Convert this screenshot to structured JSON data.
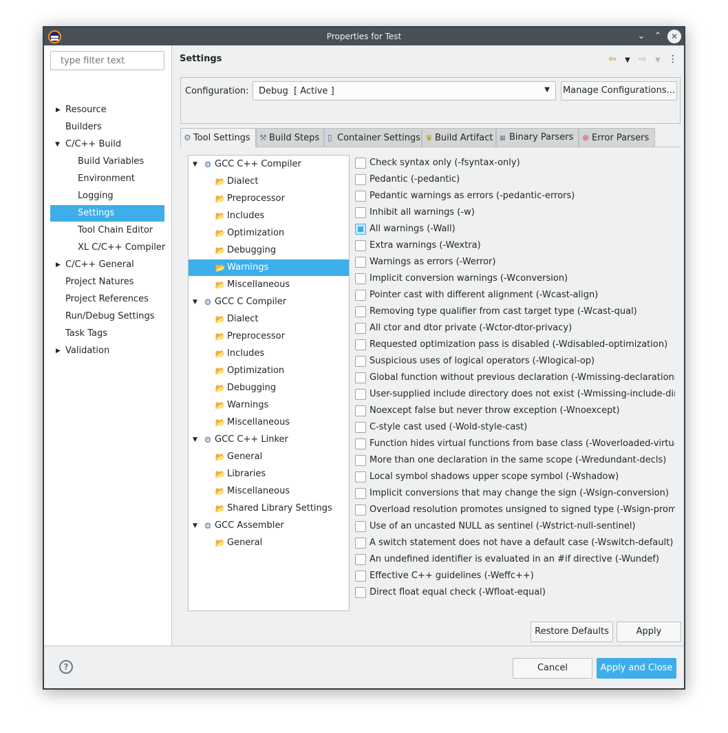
{
  "window": {
    "title": "Properties for Test"
  },
  "left": {
    "filter_placeholder": "type filter text",
    "items": [
      {
        "label": "Resource"
      },
      {
        "label": "Builders"
      },
      {
        "label": "C/C++ Build"
      },
      {
        "label": "Build Variables"
      },
      {
        "label": "Environment"
      },
      {
        "label": "Logging"
      },
      {
        "label": "Settings"
      },
      {
        "label": "Tool Chain Editor"
      },
      {
        "label": "XL C/C++ Compiler"
      },
      {
        "label": "C/C++ General"
      },
      {
        "label": "Project Natures"
      },
      {
        "label": "Project References"
      },
      {
        "label": "Run/Debug Settings"
      },
      {
        "label": "Task Tags"
      },
      {
        "label": "Validation"
      }
    ]
  },
  "main": {
    "title": "Settings",
    "config_label": "Configuration:",
    "config_value": "Debug  [ Active ]",
    "manage_label": "Manage Configurations...",
    "tabs": [
      {
        "label": "Tool Settings"
      },
      {
        "label": "Build Steps"
      },
      {
        "label": "Container Settings"
      },
      {
        "label": "Build Artifact"
      },
      {
        "label": "Binary Parsers"
      },
      {
        "label": "Error Parsers"
      }
    ],
    "tree": [
      {
        "label": "GCC C++ Compiler"
      },
      {
        "label": "Dialect"
      },
      {
        "label": "Preprocessor"
      },
      {
        "label": "Includes"
      },
      {
        "label": "Optimization"
      },
      {
        "label": "Debugging"
      },
      {
        "label": "Warnings"
      },
      {
        "label": "Miscellaneous"
      },
      {
        "label": "GCC C Compiler"
      },
      {
        "label": "Dialect"
      },
      {
        "label": "Preprocessor"
      },
      {
        "label": "Includes"
      },
      {
        "label": "Optimization"
      },
      {
        "label": "Debugging"
      },
      {
        "label": "Warnings"
      },
      {
        "label": "Miscellaneous"
      },
      {
        "label": "GCC C++ Linker"
      },
      {
        "label": "General"
      },
      {
        "label": "Libraries"
      },
      {
        "label": "Miscellaneous"
      },
      {
        "label": "Shared Library Settings"
      },
      {
        "label": "GCC Assembler"
      },
      {
        "label": "General"
      }
    ],
    "options": [
      {
        "label": "Check syntax only (-fsyntax-only)"
      },
      {
        "label": "Pedantic (-pedantic)"
      },
      {
        "label": "Pedantic warnings as errors (-pedantic-errors)"
      },
      {
        "label": "Inhibit all warnings (-w)"
      },
      {
        "label": "All warnings (-Wall)"
      },
      {
        "label": "Extra warnings (-Wextra)"
      },
      {
        "label": "Warnings as errors (-Werror)"
      },
      {
        "label": "Implicit conversion warnings (-Wconversion)"
      },
      {
        "label": "Pointer cast with different alignment (-Wcast-align)"
      },
      {
        "label": "Removing type qualifier from cast target type (-Wcast-qual)"
      },
      {
        "label": "All ctor and dtor private (-Wctor-dtor-privacy)"
      },
      {
        "label": "Requested optimization pass is disabled (-Wdisabled-optimization)"
      },
      {
        "label": "Suspicious uses of logical operators (-Wlogical-op)"
      },
      {
        "label": "Global function without previous declaration (-Wmissing-declarations)"
      },
      {
        "label": "User-supplied include directory does not exist (-Wmissing-include-dirs)"
      },
      {
        "label": "Noexcept false but never throw exception (-Wnoexcept)"
      },
      {
        "label": "C-style cast used (-Wold-style-cast)"
      },
      {
        "label": "Function hides virtual functions from base class (-Woverloaded-virtual)"
      },
      {
        "label": "More than one declaration in the same scope (-Wredundant-decls)"
      },
      {
        "label": "Local symbol shadows upper scope symbol (-Wshadow)"
      },
      {
        "label": "Implicit conversions that may change the sign (-Wsign-conversion)"
      },
      {
        "label": "Overload resolution promotes unsigned to signed type (-Wsign-promo)"
      },
      {
        "label": "Use of an uncasted NULL as sentinel (-Wstrict-null-sentinel)"
      },
      {
        "label": "A switch statement does not have a default case (-Wswitch-default)"
      },
      {
        "label": "An undefined identifier is evaluated in an #if directive (-Wundef)"
      },
      {
        "label": "Effective C++ guidelines (-Weffc++)"
      },
      {
        "label": "Direct float equal check (-Wfloat-equal)"
      }
    ],
    "restore_label": "Restore Defaults",
    "apply_label": "Apply"
  },
  "footer": {
    "cancel_label": "Cancel",
    "apply_close_label": "Apply and Close"
  }
}
